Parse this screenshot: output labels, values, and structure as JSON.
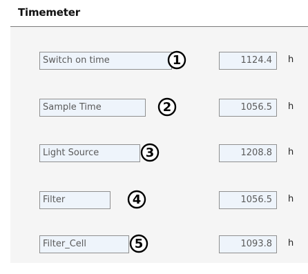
{
  "window": {
    "title": "Timemeter"
  },
  "rows": [
    {
      "label": "Switch on time",
      "marker": "1",
      "value": "1124.4",
      "unit": "h"
    },
    {
      "label": "Sample Time",
      "marker": "2",
      "value": "1056.5",
      "unit": "h"
    },
    {
      "label": "Light Source",
      "marker": "3",
      "value": "1208.8",
      "unit": "h"
    },
    {
      "label": "Filter",
      "marker": "4",
      "value": "1056.5",
      "unit": "h"
    },
    {
      "label": "Filter_Cell",
      "marker": "5",
      "value": "1093.8",
      "unit": "h"
    }
  ],
  "colors": {
    "panel_background": "#f5f5f5",
    "field_background": "#eef4fb",
    "field_border": "#8f8f8f",
    "field_text": "#5a5a5a",
    "marker": "#000000"
  },
  "icons": {
    "marker": "circled-number-icon"
  }
}
